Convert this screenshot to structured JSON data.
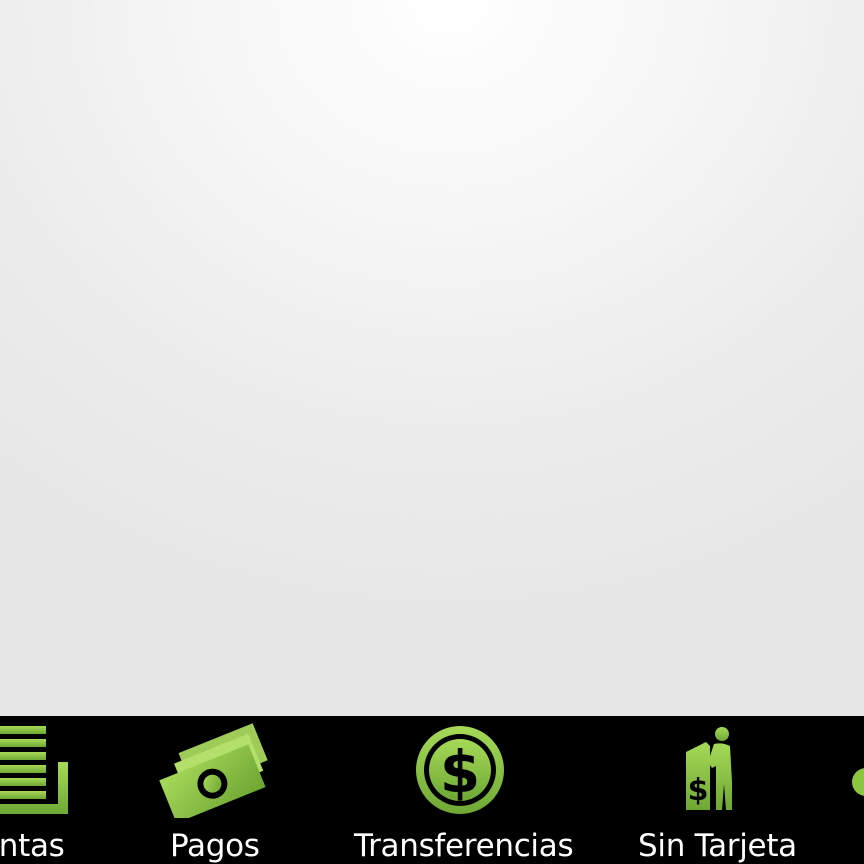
{
  "colors": {
    "icon_green": "#8cc63f",
    "icon_green_dark": "#5e9a2a",
    "tabbar_bg": "#000000",
    "tab_label": "#ffffff"
  },
  "tabbar": {
    "items": [
      {
        "label": "entas",
        "icon": "list-stack-icon"
      },
      {
        "label": "Pagos",
        "icon": "money-bill-icon"
      },
      {
        "label": "Transferencias",
        "icon": "dollar-circle-icon"
      },
      {
        "label": "Sin Tarjeta",
        "icon": "atm-person-icon"
      },
      {
        "label": "",
        "icon": "partial-circle-icon"
      }
    ]
  }
}
